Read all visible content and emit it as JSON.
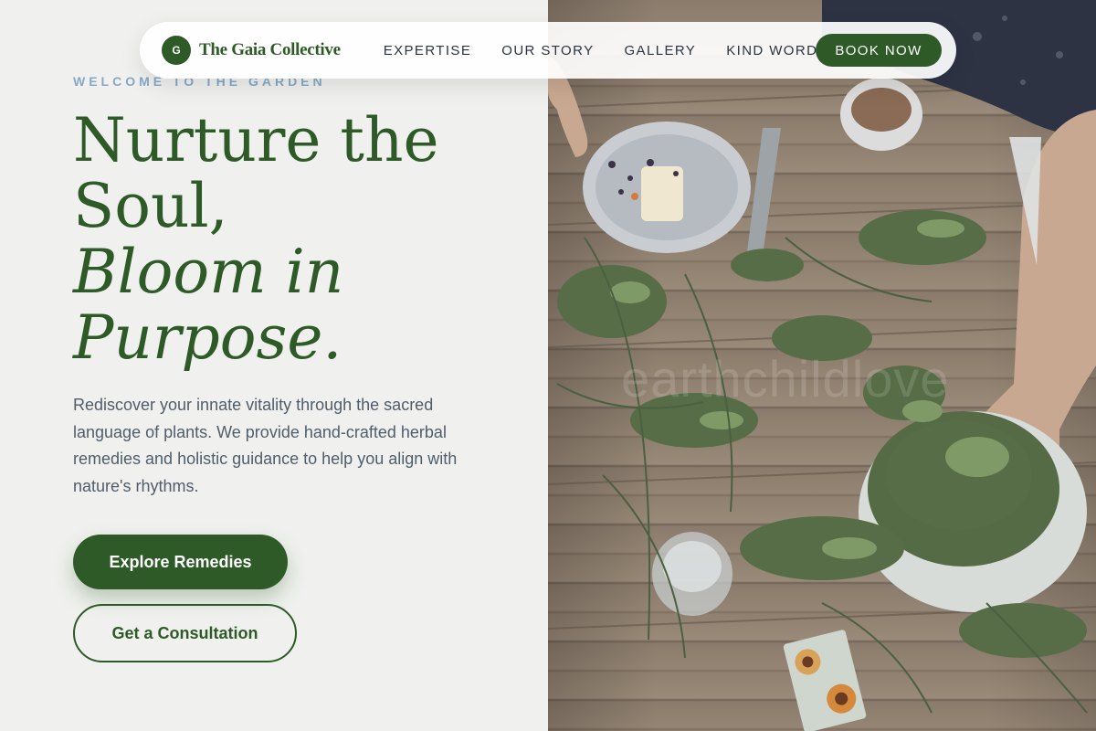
{
  "brand": {
    "mark_letter": "G",
    "name": "The Gaia Collective"
  },
  "nav": {
    "links": [
      {
        "label": "EXPERTISE"
      },
      {
        "label": "OUR STORY"
      },
      {
        "label": "GALLERY"
      },
      {
        "label": "KIND WORDS"
      }
    ],
    "cta_label": "BOOK NOW"
  },
  "hero": {
    "eyebrow": "WELCOME TO THE GARDEN",
    "headline": {
      "line1": "Nurture the",
      "line2": "Soul,",
      "line3": "Bloom in",
      "line4": "Purpose."
    },
    "lead": "Rediscover your innate vitality through the sacred language of plants. We provide hand-crafted herbal remedies and holistic guidance to help you align with nature's rhythms.",
    "primary_button": "Explore Remedies",
    "secondary_button": "Get a Consultation"
  },
  "photo": {
    "watermark": "earthchildlove"
  },
  "colors": {
    "brand_green": "#2d5a27",
    "eyebrow_blue": "#87a9c6",
    "body_text": "#4f5d6c",
    "page_bg": "#f0f1ee"
  },
  "icons": {
    "brand_mark": "circle-letter-logo"
  }
}
